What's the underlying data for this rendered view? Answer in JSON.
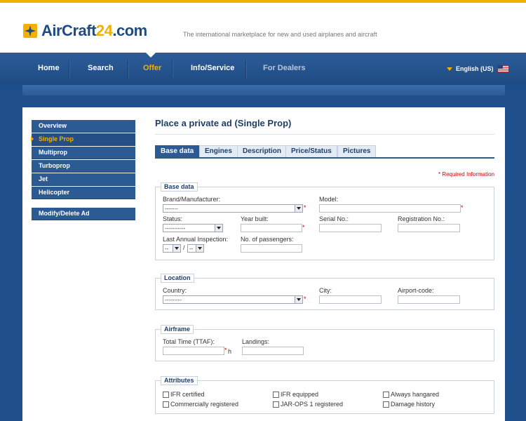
{
  "brand": {
    "name_part1": "AirCraft",
    "name_num": "24",
    "name_suffix": ".com",
    "tagline": "The international marketplace for new and used airplanes and aircraft"
  },
  "nav": {
    "items": [
      "Home",
      "Search",
      "Offer",
      "Info/Service",
      "For Dealers"
    ],
    "active": "Offer",
    "language": "English (US)"
  },
  "sidebar": {
    "items": [
      "Overview",
      "Single Prop",
      "Multiprop",
      "Turboprop",
      "Jet",
      "Helicopter"
    ],
    "active": "Single Prop",
    "extra": "Modify/Delete Ad"
  },
  "page": {
    "title": "Place a private ad (Single Prop)",
    "tabs": [
      "Base data",
      "Engines",
      "Description",
      "Price/Status",
      "Pictures"
    ],
    "active_tab": "Base data",
    "required_note": "* Required Information"
  },
  "base_data": {
    "legend": "Base data",
    "brand_label": "Brand/Manufacturer:",
    "brand_value": "-------",
    "model_label": "Model:",
    "status_label": "Status:",
    "status_value": "-----------",
    "year_label": "Year built:",
    "serial_label": "Serial No.:",
    "registration_label": "Registration No.:",
    "inspection_label": "Last Annual Inspection:",
    "inspection_month": "--",
    "inspection_sep": "/",
    "inspection_year": "--",
    "passengers_label": "No. of passengers:"
  },
  "location": {
    "legend": "Location",
    "country_label": "Country:",
    "country_value": "---------",
    "city_label": "City:",
    "airport_label": "Airport-code:"
  },
  "airframe": {
    "legend": "Airframe",
    "ttaf_label": "Total Time (TTAF):",
    "ttaf_unit": "h",
    "landings_label": "Landings:"
  },
  "attributes": {
    "legend": "Attributes",
    "options": [
      "IFR certified",
      "IFR equipped",
      "Always hangared",
      "Commercially registered",
      "JAR-OPS 1 registered",
      "Damage history"
    ]
  },
  "colors": {
    "accent": "#f2b000",
    "navy": "#1f4b82",
    "required": "#cc0000"
  }
}
